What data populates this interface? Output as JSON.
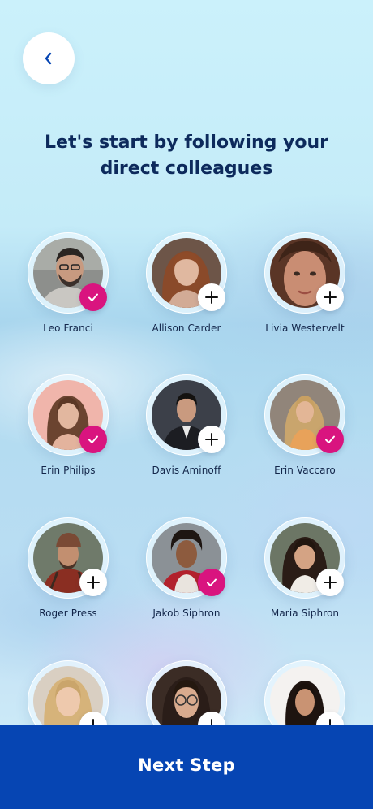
{
  "header": {
    "title_line1": "Let's start by following your",
    "title_line2": "direct colleagues"
  },
  "colors": {
    "title": "#0d2a5c",
    "followed_badge": "#d9147f",
    "add_badge": "#ffffff",
    "primary_button": "#0645b3",
    "back_arrow": "#0645b3"
  },
  "icons": {
    "back": "chevron-left-icon",
    "followed": "check-icon",
    "add": "plus-icon"
  },
  "colleagues": [
    {
      "name": "Leo Franci",
      "followed": true
    },
    {
      "name": "Allison Carder",
      "followed": false
    },
    {
      "name": "Livia Westervelt",
      "followed": false
    },
    {
      "name": "Erin Philips",
      "followed": true
    },
    {
      "name": "Davis Aminoff",
      "followed": false
    },
    {
      "name": "Erin Vaccaro",
      "followed": true
    },
    {
      "name": "Roger Press",
      "followed": false
    },
    {
      "name": "Jakob Siphron",
      "followed": true
    },
    {
      "name": "Maria Siphron",
      "followed": false
    },
    {
      "name": "",
      "followed": false
    },
    {
      "name": "",
      "followed": false
    },
    {
      "name": "",
      "followed": false
    }
  ],
  "footer": {
    "next_label": "Next Step"
  }
}
